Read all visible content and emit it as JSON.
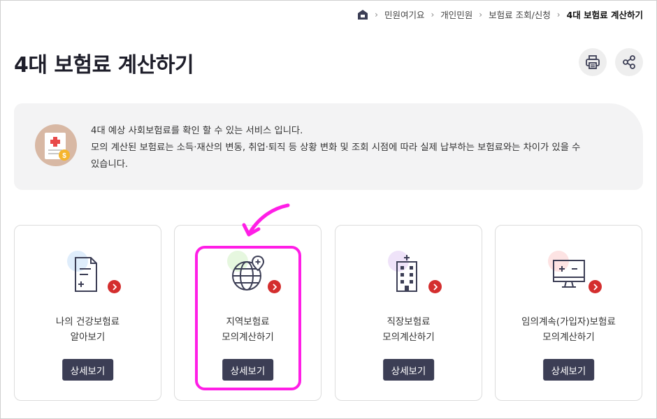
{
  "breadcrumb": {
    "items": [
      "민원여기요",
      "개인민원",
      "보험료 조회/신청",
      "4대 보험료 계산하기"
    ]
  },
  "page": {
    "title": "4대 보험료 계산하기"
  },
  "info": {
    "line1": "4대 예상 사회보험료를 확인 할 수 있는 서비스 입니다.",
    "line2": "모의 계산된 보험료는 소득·재산의 변동, 취업·퇴직 등 상황 변화 및 조회 시점에 따라 실제 납부하는 보험료와는 차이가 있을 수",
    "line3": "있습니다."
  },
  "cards": [
    {
      "line1": "나의 건강보험료",
      "line2": "알아보기",
      "button": "상세보기",
      "accent": "#dcebfb",
      "icon": "document-plus-icon"
    },
    {
      "line1": "지역보험료",
      "line2": "모의계산하기",
      "button": "상세보기",
      "accent": "#e3f6dc",
      "icon": "globe-location-icon"
    },
    {
      "line1": "직장보험료",
      "line2": "모의계산하기",
      "button": "상세보기",
      "accent": "#ede0f8",
      "icon": "office-building-icon"
    },
    {
      "line1": "임의계속(가입자)보험료",
      "line2": "모의계산하기",
      "button": "상세보기",
      "accent": "#fde0e0",
      "icon": "monitor-calculator-icon"
    }
  ],
  "colors": {
    "highlight": "#ff1ee6",
    "badge": "#d42e2e",
    "button": "#3c3e55"
  }
}
